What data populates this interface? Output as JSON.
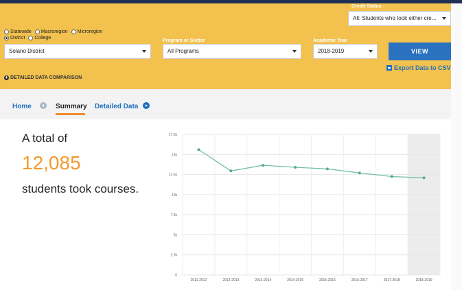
{
  "filters": {
    "credit_status": {
      "label": "Credit Status",
      "value": "All: Students who took either cre..."
    },
    "scope_options": [
      {
        "label": "Statewide",
        "selected": false
      },
      {
        "label": "Macroregion",
        "selected": false
      },
      {
        "label": "Microregion",
        "selected": false
      }
    ],
    "scope_options_2": [
      {
        "label": "District",
        "selected": true
      },
      {
        "label": "College",
        "selected": false
      }
    ],
    "district": {
      "value": "Solano District"
    },
    "program": {
      "label": "Program or Sector",
      "value": "All Programs"
    },
    "year": {
      "label": "Academic Year",
      "value": "2018-2019"
    },
    "view_button": "VIEW",
    "export_link": "Export Data to CSV",
    "detailed_comparison": "DETAILED DATA COMPARISON"
  },
  "nav": {
    "home": "Home",
    "summary": "Summary",
    "detailed": "Detailed Data"
  },
  "summary": {
    "prefix": "A total of",
    "number": "12,085",
    "suffix": "students took courses."
  },
  "colors": {
    "filter_bg": "#f2c14e",
    "accent_orange": "#f29a2e",
    "link_blue": "#1f6fbf",
    "line": "#6fbf9c"
  },
  "chart_data": {
    "type": "line",
    "categories": [
      "2011-2012",
      "2012-2013",
      "2013-2014",
      "2014-2015",
      "2015-2016",
      "2016-2017",
      "2017-2018",
      "2018-2019"
    ],
    "values": [
      15600,
      12950,
      13650,
      13400,
      13200,
      12700,
      12250,
      12085
    ],
    "y_ticks": [
      "0",
      "2.5k",
      "5k",
      "7.5k",
      "10k",
      "12.5k",
      "15k",
      "17.5k"
    ],
    "ylim": [
      0,
      17500
    ],
    "highlight_category": "2018-2019",
    "grid": true
  }
}
